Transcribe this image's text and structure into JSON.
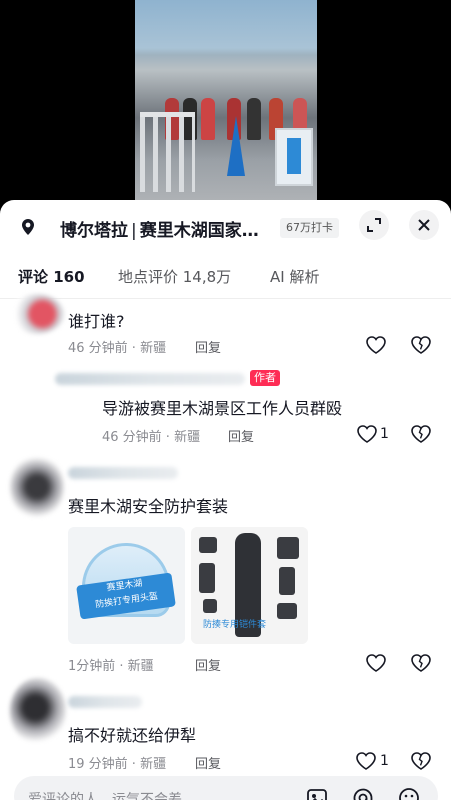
{
  "location": {
    "name": "博尔塔拉",
    "separator": "|",
    "detail": "赛里木湖国家…",
    "checkin": "67万打卡"
  },
  "icons": {
    "pin": "location-pin-icon",
    "expand": "expand-icon",
    "close": "close-icon",
    "like": "heart-icon",
    "dislike": "broken-heart-icon",
    "image": "image-icon",
    "mention": "at-icon",
    "emoji": "emoji-icon"
  },
  "tabs": [
    {
      "label": "评论 160",
      "active": true
    },
    {
      "label": "地点评价 14,8万",
      "active": false
    },
    {
      "label": "AI 解析",
      "active": false
    }
  ],
  "comments": [
    {
      "text": "谁打谁?",
      "time": "46 分钟前 · 新疆",
      "reply": "回复",
      "likes": ""
    },
    {
      "text": "导游被赛里木湖景区工作人员群殴",
      "time": "46 分钟前 · 新疆",
      "reply": "回复",
      "likes": "1",
      "tag": "作者"
    },
    {
      "text": "赛里木湖安全防护套装",
      "time": "1分钟前 · 新疆",
      "reply": "回复",
      "likes": "",
      "images": [
        {
          "caption_line1": "赛里木湖",
          "caption_line2": "防挨打专用头盔"
        },
        {
          "caption": "防揍专用铠件套"
        }
      ]
    },
    {
      "text": "搞不好就还给伊犁",
      "time": "19 分钟前 · 新疆",
      "reply": "回复",
      "likes": "1"
    }
  ],
  "input": {
    "placeholder": "爱评论的人，运气不会差"
  },
  "colors": {
    "accent": "#fe2c55",
    "brand_blue": "#2d8ad6"
  }
}
